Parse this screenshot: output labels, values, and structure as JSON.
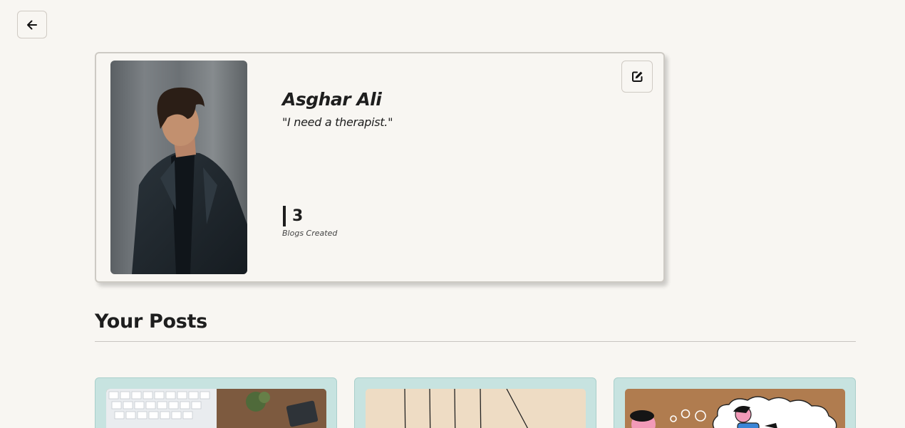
{
  "profile": {
    "name": "Asghar Ali",
    "quote": "\"I need a therapist.\"",
    "blogs_count": "3",
    "blogs_label": "Blogs Created"
  },
  "posts_section": {
    "title": "Your Posts"
  },
  "icons": {
    "back": "arrow-left-icon",
    "edit": "edit-square-icon"
  },
  "colors": {
    "page_background": "#f8f6f2",
    "card_teal": "#c7e3e0",
    "text_dark": "#1e1e1e"
  }
}
